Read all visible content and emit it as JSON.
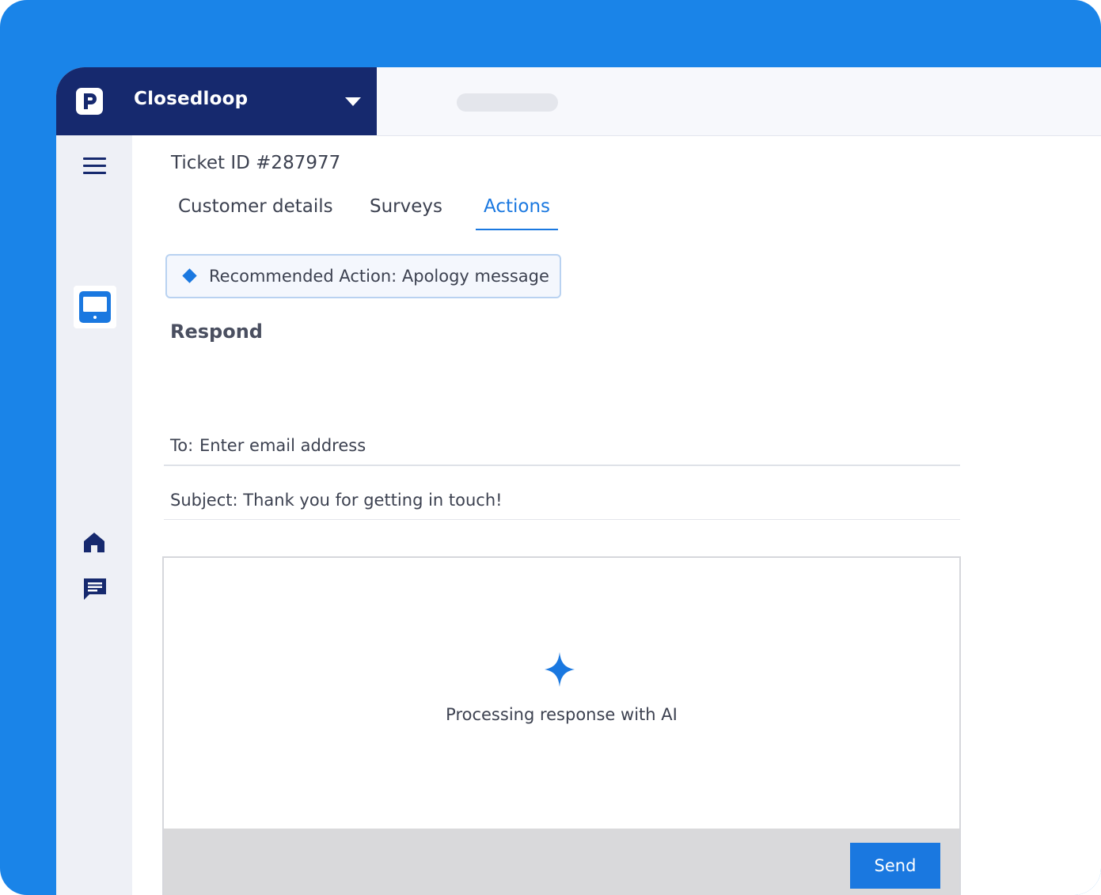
{
  "app": {
    "brand_name": "Closedloop",
    "logo_icon": "p-logo-icon",
    "caret_icon": "caret-down-icon"
  },
  "colors": {
    "frame_blue": "#1a84e8",
    "nav_navy": "#16296e",
    "accent": "#1a78e0",
    "footer_gray": "#d9d9db"
  },
  "ticket": {
    "id_label": "Ticket ID #287977"
  },
  "tabs": [
    {
      "label": "Customer details",
      "active": false
    },
    {
      "label": "Surveys",
      "active": false
    },
    {
      "label": "Actions",
      "active": true
    }
  ],
  "recommendation": {
    "text": "Recommended Action: Apology message",
    "icon": "diamond-icon"
  },
  "respond": {
    "heading": "Respond",
    "to_label": "To:",
    "to_placeholder": "Enter email address",
    "subject_label": "Subject: Thank you for getting in touch!"
  },
  "composer": {
    "status_text": "Processing response with AI",
    "status_icon": "sparkle-icon",
    "send_label": "Send"
  },
  "rail": {
    "icons": [
      "menu-icon",
      "monitor-icon",
      "home-icon",
      "chat-icon"
    ]
  }
}
